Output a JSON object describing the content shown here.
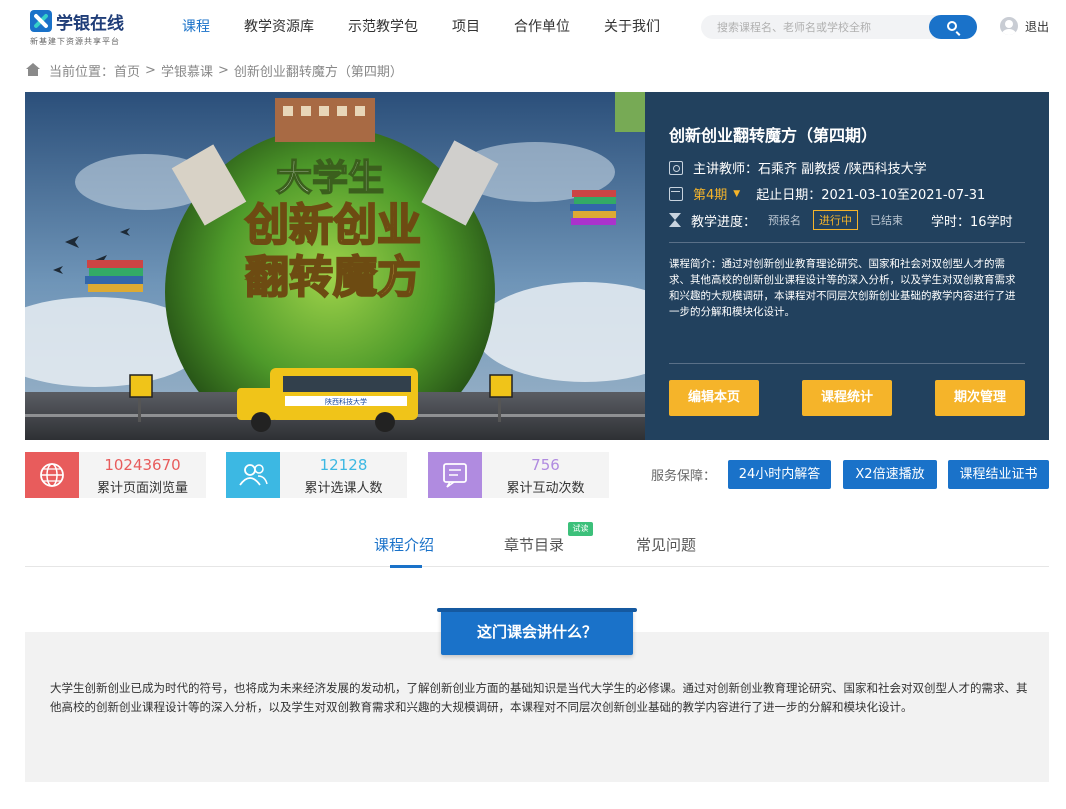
{
  "header": {
    "logo_title": "学银在线",
    "logo_subtitle": "新基建下资源共享平台",
    "nav": [
      "课程",
      "教学资源库",
      "示范教学包",
      "项目",
      "合作单位",
      "关于我们"
    ],
    "search_placeholder": "搜索课程名、老师名或学校全称",
    "logout": "退出"
  },
  "breadcrumb": {
    "prefix": "当前位置：",
    "items": [
      "首页",
      "学银慕课",
      "创新创业翻转魔方（第四期）"
    ],
    "separator": ">"
  },
  "banner": {
    "image_text": {
      "line1": "大学生",
      "line2": "创新创业",
      "line3": "翻转魔方",
      "bus_text": "陕西科技大学"
    }
  },
  "course": {
    "title": "创新创业翻转魔方（第四期）",
    "teacher_label": "主讲教师：",
    "teacher": "石乘齐 副教授 /陕西科技大学",
    "term": "第4期",
    "date_label": "起止日期：",
    "dates": "2021-03-10至2021-07-31",
    "progress_label": "教学进度：",
    "stages": [
      "预报名",
      "进行中",
      "已结束"
    ],
    "hours_label": "学时：",
    "hours": "16学时",
    "intro_label": "课程简介：",
    "intro": "通过对创新创业教育理论研究、国家和社会对双创型人才的需求、其他高校的创新创业课程设计等的深入分析，以及学生对双创教育需求和兴趣的大规模调研，本课程对不同层次创新创业基础的教学内容进行了进一步的分解和模块化设计。",
    "buttons": [
      "编辑本页",
      "课程统计",
      "期次管理"
    ]
  },
  "stats": [
    {
      "value": "10243670",
      "label": "累计页面浏览量",
      "color": "#e85c5c"
    },
    {
      "value": "12128",
      "label": "累计选课人数",
      "color": "#3cb8e3"
    },
    {
      "value": "756",
      "label": "累计互动次数",
      "color": "#b08be0"
    }
  ],
  "service": {
    "label": "服务保障：",
    "items": [
      "24小时内解答",
      "X2倍速播放",
      "课程结业证书"
    ]
  },
  "tabs": {
    "items": [
      "课程介绍",
      "章节目录",
      "常见问题"
    ],
    "badge": "试读"
  },
  "content": {
    "heading": "这门课会讲什么？",
    "body": "大学生创新创业已成为时代的符号，也将成为未来经济发展的发动机，了解创新创业方面的基础知识是当代大学生的必修课。通过对创新创业教育理论研究、国家和社会对双创型人才的需求、其他高校的创新创业课程设计等的深入分析，以及学生对双创教育需求和兴趣的大规模调研，本课程对不同层次创新创业基础的教学内容进行了进一步的分解和模块化设计。"
  },
  "colors": {
    "primary": "#1a72c9",
    "accent": "#f5b42a",
    "banner_panel": "#22415e"
  }
}
